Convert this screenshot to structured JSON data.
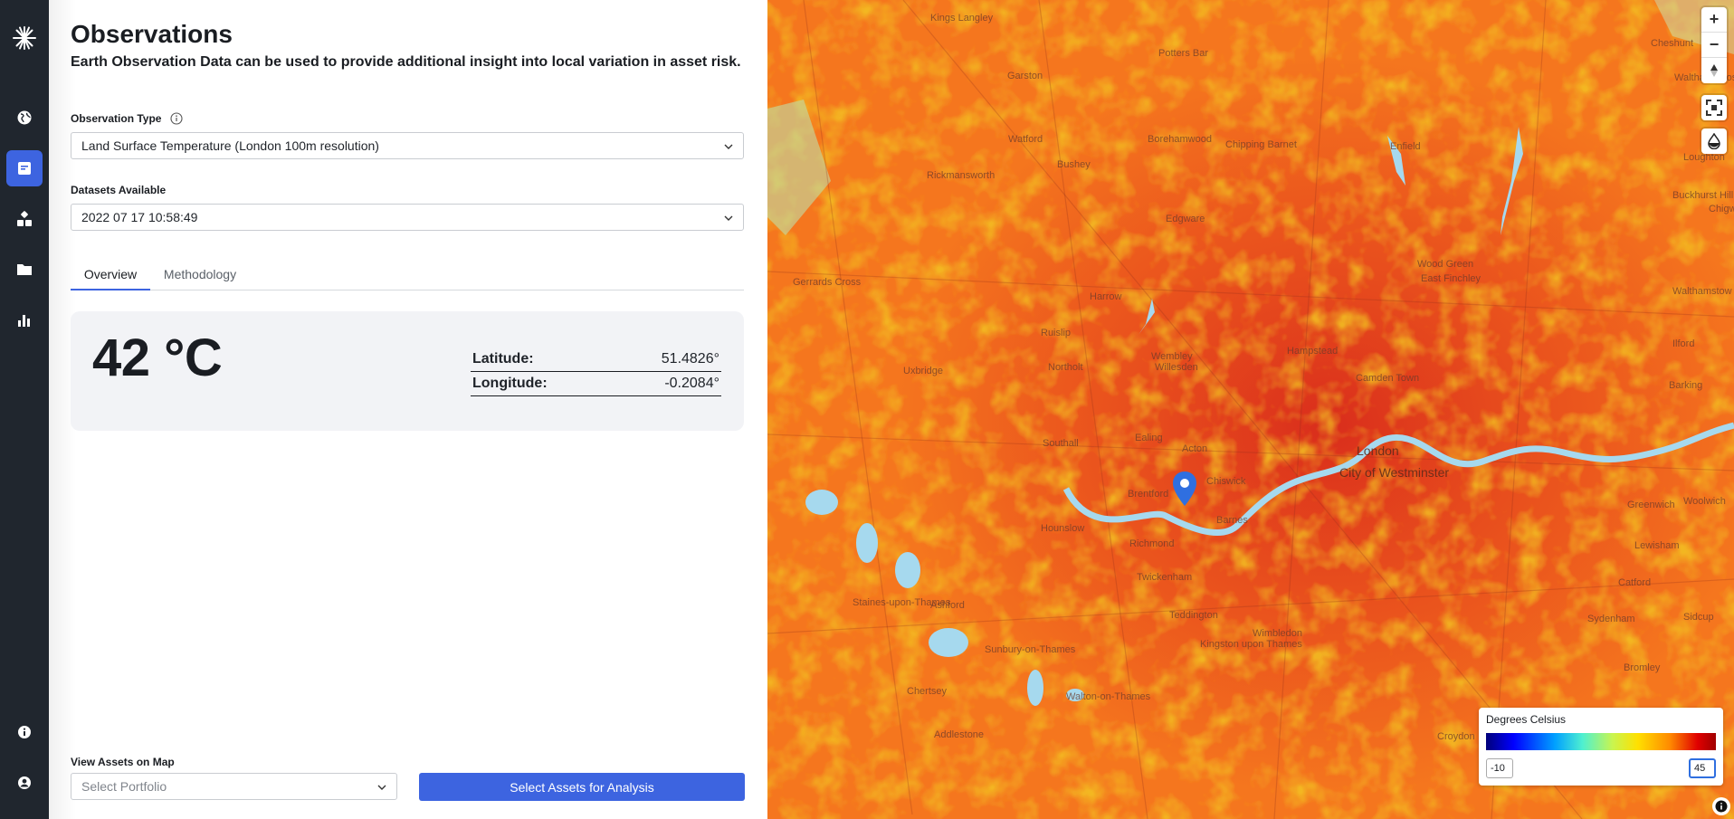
{
  "sidebar": {
    "items": [
      "logo-icon",
      "globe-icon",
      "report-icon",
      "network-icon",
      "folder-icon",
      "bar-chart-icon",
      "info-icon",
      "account-icon"
    ]
  },
  "header": {
    "title": "Observations",
    "subtitle": "Earth Observation Data can be used to provide additional insight into local variation in asset risk."
  },
  "observation_type": {
    "label": "Observation Type",
    "value": "Land Surface Temperature (London 100m resolution)"
  },
  "datasets": {
    "label": "Datasets Available",
    "value": "2022 07 17 10:58:49"
  },
  "tabs": [
    {
      "label": "Overview",
      "active": true
    },
    {
      "label": "Methodology",
      "active": false
    }
  ],
  "reading": {
    "temperature": "42 °C",
    "latitude_label": "Latitude:",
    "latitude": "51.4826°",
    "longitude_label": "Longitude:",
    "longitude": "-0.2084°"
  },
  "assets": {
    "label": "View Assets on Map",
    "placeholder": "Select Portfolio",
    "button": "Select Assets for Analysis"
  },
  "map": {
    "labels": [
      "Kings Langley",
      "Potters Bar",
      "Cheshunt",
      "Waltham Cross",
      "Garston",
      "Borehamwood",
      "Chipping Barnet",
      "Enfield",
      "Watford",
      "Bushey",
      "Loughton",
      "Rickmansworth",
      "Buckhurst Hill",
      "Chigwell",
      "Edgware",
      "Wood Green",
      "Walthamstow",
      "Gerrards Cross",
      "East Finchley",
      "Harrow",
      "Ruislip",
      "Wembley",
      "Hampstead",
      "Ilford",
      "Northolt",
      "Willesden",
      "Camden Town",
      "Uxbridge",
      "Barking",
      "Southall",
      "Ealing",
      "Acton",
      "London",
      "City of Westminster",
      "Brentford",
      "Chiswick",
      "Hounslow",
      "Barnes",
      "Richmond",
      "Greenwich",
      "Woolwich",
      "Lewisham",
      "Twickenham",
      "Ashford",
      "Staines-upon-Thames",
      "Wimbledon",
      "Catford",
      "Teddington",
      "Kingston upon Thames",
      "Sydenham",
      "Sidcup",
      "Sunbury-on-Thames",
      "Bromley",
      "Chertsey",
      "Walton-on-Thames",
      "Croydon",
      "Addlestone"
    ],
    "legend": {
      "title": "Degrees Celsius",
      "min": "-10",
      "max": "45"
    },
    "controls": [
      "zoom-in",
      "zoom-out",
      "reset-bearing",
      "fullscreen",
      "layer-style"
    ],
    "colors": {
      "hot": "#e0251a",
      "warm": "#f5761e",
      "mild": "#f3c322",
      "water": "#a6d9ee",
      "pin": "#2f6fe0"
    }
  }
}
